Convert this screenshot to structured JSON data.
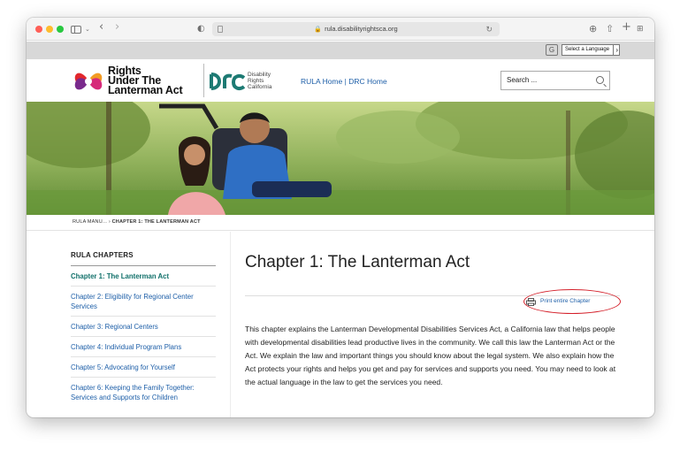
{
  "browser": {
    "url": "rula.disabilityrightsca.org",
    "back_icon": "chevron-left-icon",
    "forward_icon": "chevron-right-icon"
  },
  "language": {
    "select_label": "Select a Language"
  },
  "header": {
    "rula_line1": "Rights",
    "rula_line2": "Under The",
    "rula_line3": "Lanterman Act",
    "drc_line1": "Disability",
    "drc_line2": "Rights",
    "drc_line3": "California",
    "nav_home": "RULA Home",
    "nav_sep": "|",
    "nav_drc": "DRC Home",
    "search_placeholder": "Search ..."
  },
  "breadcrumb": {
    "parent": "RULA MANU...",
    "sep": "›",
    "current": "CHAPTER 1: THE LANTERMAN ACT"
  },
  "sidebar": {
    "title": "RULA CHAPTERS",
    "items": [
      {
        "label": "Chapter 1: The Lanterman Act"
      },
      {
        "label": "Chapter 2: Eligibility for Regional Center Services"
      },
      {
        "label": "Chapter 3: Regional Centers"
      },
      {
        "label": "Chapter 4: Individual Program Plans"
      },
      {
        "label": "Chapter 5: Advocating for Yourself"
      },
      {
        "label": "Chapter 6: Keeping the Family Together: Services and Supports for Children"
      }
    ]
  },
  "main": {
    "title": "Chapter 1: The Lanterman Act",
    "print_label": "Print entire Chapter",
    "intro": "This chapter explains the Lanterman Developmental Disabilities Services Act, a California law that helps people with developmental disabilities lead productive lives in the community. We call this law the Lanterman Act or the Act. We explain the law and important things you should know about the legal system. We also explain how the Act protects your rights and helps you get and pay for services and supports you need. You may need to look at the actual language in the law to get the services you need."
  },
  "colors": {
    "link": "#1e5fa8",
    "active_chapter": "#11706a",
    "drc_teal": "#1d7a73",
    "highlight_ring": "#d4202a"
  }
}
